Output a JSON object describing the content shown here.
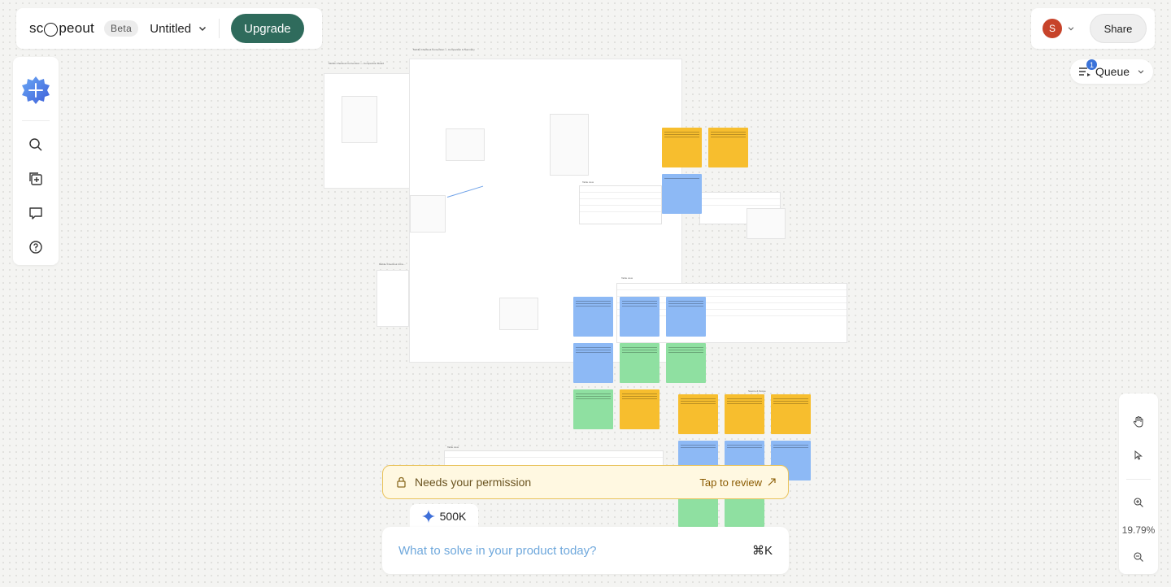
{
  "app": {
    "logo_text_left": "sc",
    "logo_text_right": "peout",
    "beta_label": "Beta",
    "doc_title": "Untitled",
    "upgrade_label": "Upgrade"
  },
  "header_right": {
    "avatar_initial": "S",
    "share_label": "Share",
    "queue_label": "Queue",
    "queue_count": "1"
  },
  "left_toolbar": {
    "tools": [
      "add-icon",
      "search-icon",
      "add-frame-icon",
      "comment-icon",
      "help-icon"
    ]
  },
  "zoom": {
    "level": "19.79%"
  },
  "canvas": {
    "frame_titles": {
      "main": "Mobile Checkout Conversion — Comparison & Summary",
      "board": "Mobile Checkout Conversion — Comparison Board",
      "small": "Mobile Checkout Conv...",
      "note": "Mobile Checkout Conversion — Comparison Board",
      "source": "Source & Scope",
      "table1": "Table view",
      "table2": "Table view",
      "table3": "Table view"
    }
  },
  "permission": {
    "text": "Needs your permission",
    "action": "Tap to review"
  },
  "credits": {
    "value": "500K"
  },
  "prompt": {
    "placeholder": "What to solve in your product today?",
    "shortcut": "⌘K"
  },
  "colors": {
    "accent": "#2f6b5c",
    "sticky_yellow": "#f7be2e",
    "sticky_blue": "#8db9f5",
    "sticky_green": "#8fe0a1",
    "permission_border": "#e9c35c"
  }
}
